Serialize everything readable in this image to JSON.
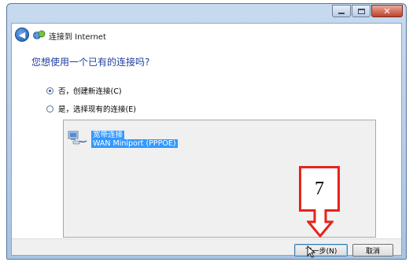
{
  "dialog": {
    "title": "连接到 Internet",
    "question": "您想使用一个已有的连接吗?",
    "options": [
      {
        "label": "否，创建新连接(C)",
        "selected": true
      },
      {
        "label": "是，选择现有的连接(E)",
        "selected": false
      }
    ],
    "connection": {
      "name": "宽带连接",
      "device": "WAN Miniport (PPPOE)"
    },
    "buttons": {
      "next": "下一步(N)",
      "cancel": "取消"
    }
  },
  "annotation": {
    "step_number": "7",
    "color": "#e8231b"
  },
  "icons": [
    "back-arrow-icon",
    "internet-connection-icon",
    "network-connection-icon",
    "minimize-icon",
    "maximize-icon",
    "close-icon",
    "mouse-cursor-icon"
  ]
}
